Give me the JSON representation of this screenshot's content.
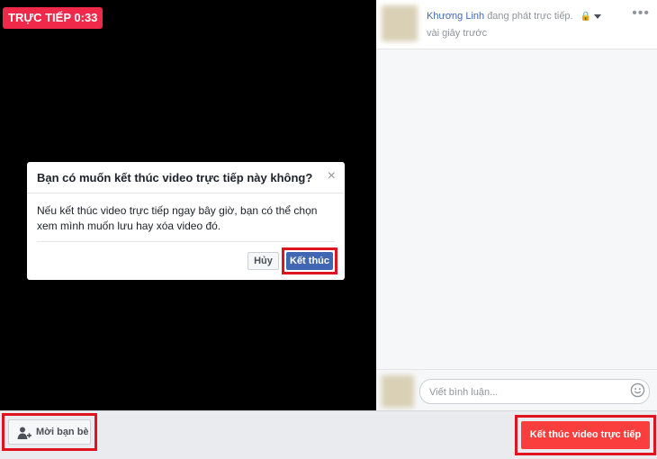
{
  "live": {
    "badge": "TRỰC TIẾP 0:33"
  },
  "post": {
    "author": "Khương Linh",
    "action": "đang phát trực tiếp.",
    "time": "vài giây trước",
    "more": "•••"
  },
  "dialog": {
    "title": "Bạn có muốn kết thúc video trực tiếp này không?",
    "close": "×",
    "body": "Nếu kết thúc video trực tiếp ngay bây giờ, bạn có thể chọn xem mình muốn lưu hay xóa video đó.",
    "cancel": "Hủy",
    "confirm": "Kết thúc"
  },
  "comment": {
    "placeholder": "Viết bình luận..."
  },
  "bottom": {
    "invite": "Mời bạn bè",
    "end_live": "Kết thúc video trực tiếp"
  }
}
